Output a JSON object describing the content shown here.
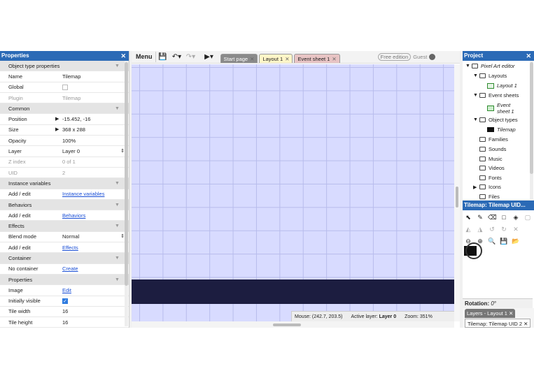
{
  "properties": {
    "title": "Properties",
    "rows": [
      {
        "type": "section",
        "k": "Object type properties"
      },
      {
        "k": "Name",
        "v": "Tilemap"
      },
      {
        "k": "Global",
        "v": "",
        "check": "off"
      },
      {
        "k": "Plugin",
        "v": "Tilemap",
        "dim": true
      },
      {
        "type": "section",
        "k": "Common"
      },
      {
        "k": "Position",
        "v": "-15.452, -16",
        "arrow": true
      },
      {
        "k": "Size",
        "v": "368 x 288",
        "arrow": true
      },
      {
        "k": "Opacity",
        "v": "100%"
      },
      {
        "k": "Layer",
        "v": "Layer 0",
        "select": true
      },
      {
        "k": "Z index",
        "v": "0 of 1",
        "dim": true
      },
      {
        "k": "UID",
        "v": "2",
        "dim": true
      },
      {
        "type": "section",
        "k": "Instance variables"
      },
      {
        "k": "Add / edit",
        "v": "Instance variables",
        "link": true
      },
      {
        "type": "section",
        "k": "Behaviors"
      },
      {
        "k": "Add / edit",
        "v": "Behaviors",
        "link": true
      },
      {
        "type": "section",
        "k": "Effects"
      },
      {
        "k": "Blend mode",
        "v": "Normal",
        "select": true
      },
      {
        "k": "Add / edit",
        "v": "Effects",
        "link": true
      },
      {
        "type": "section",
        "k": "Container"
      },
      {
        "k": "No container",
        "v": "Create",
        "link": true
      },
      {
        "type": "section",
        "k": "Properties"
      },
      {
        "k": "Image",
        "v": "Edit",
        "link": true
      },
      {
        "k": "Initially visible",
        "v": "",
        "check": "on"
      },
      {
        "k": "Tile width",
        "v": "16"
      },
      {
        "k": "Tile height",
        "v": "16"
      }
    ]
  },
  "toolbar": {
    "menu": "Menu",
    "tabs": [
      {
        "label": "Start page",
        "kind": "start"
      },
      {
        "label": "Layout 1",
        "kind": "layout"
      },
      {
        "label": "Event sheet 1",
        "kind": "event"
      }
    ],
    "free_edition": "Free edition",
    "user": "Guest"
  },
  "status": {
    "mouse": "Mouse: (242.7, 203.5)",
    "active_layer_label": "Active layer:",
    "active_layer": "Layer 0",
    "zoom": "Zoom: 351%"
  },
  "project": {
    "title": "Project",
    "items": [
      {
        "label": "Pixel Art editor",
        "icon": "folder",
        "toggle": "▼",
        "italic": true
      },
      {
        "label": "Layouts",
        "icon": "folder",
        "toggle": "▼"
      },
      {
        "label": "Layout 1",
        "icon": "layout",
        "italic": true
      },
      {
        "label": "Event sheets",
        "icon": "folder",
        "toggle": "▼"
      },
      {
        "label": "Event",
        "label2": "sheet 1",
        "icon": "event",
        "italic": true
      },
      {
        "label": "Object types",
        "icon": "folder",
        "toggle": "▼"
      },
      {
        "label": "Tilemap",
        "icon": "tilemap",
        "italic": true
      },
      {
        "label": "Families",
        "icon": "folder"
      },
      {
        "label": "Sounds",
        "icon": "folder"
      },
      {
        "label": "Music",
        "icon": "folder"
      },
      {
        "label": "Videos",
        "icon": "folder"
      },
      {
        "label": "Fonts",
        "icon": "folder"
      },
      {
        "label": "Icons",
        "icon": "folder",
        "toggle": "▶"
      },
      {
        "label": "Files",
        "icon": "folder"
      }
    ]
  },
  "tilemap_panel": {
    "title": "Tilemap: Tilemap UID...",
    "rotation_label": "Rotation:",
    "rotation_value": "0°",
    "tab_layers": "Layers - Layout 1",
    "tab_tilemap": "Tilemap: Tilemap UID 2"
  },
  "colors": {
    "accent": "#2b6ab6",
    "canvas": "#d8dbff",
    "tile_strip": "#1c1d40",
    "link": "#1a4fd6"
  }
}
